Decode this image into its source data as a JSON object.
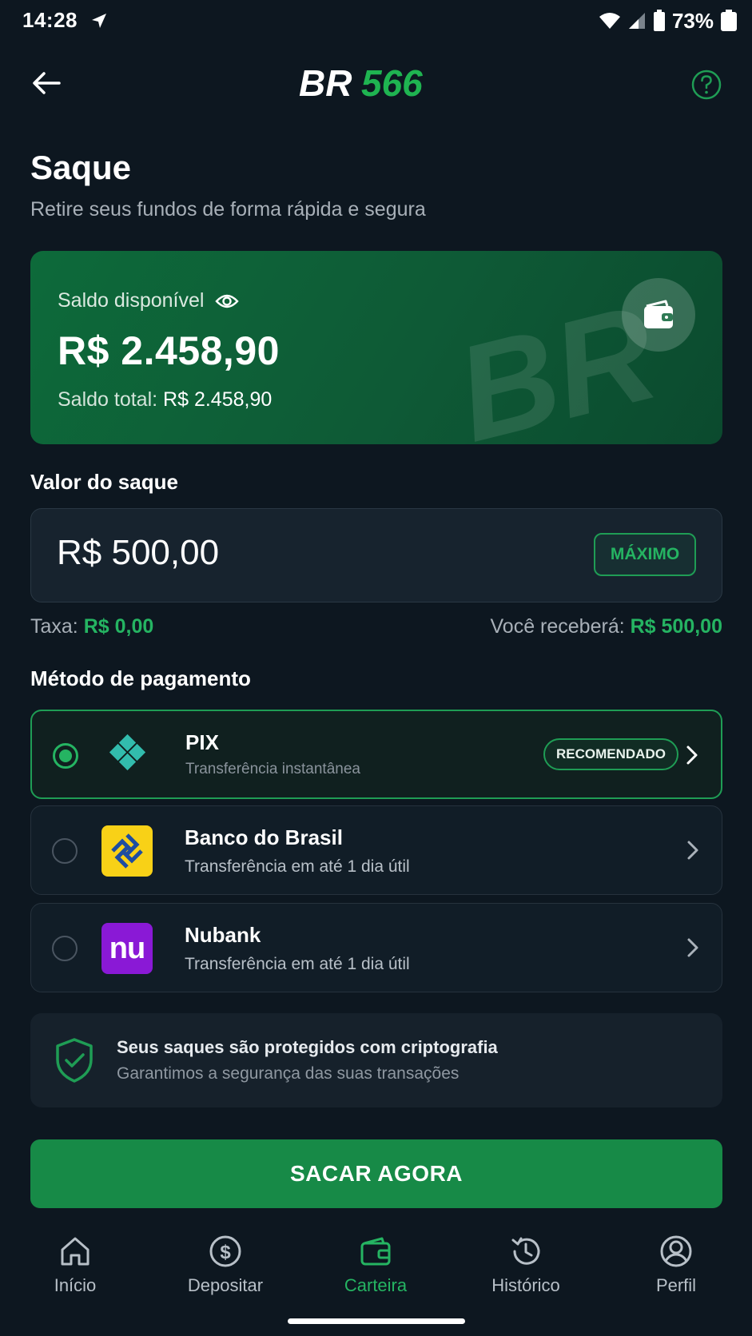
{
  "status_bar": {
    "time": "14:28",
    "battery": "73%",
    "icons": [
      "navigation-icon",
      "wifi-icon",
      "signal-icon",
      "battery-saver-icon",
      "battery-icon"
    ]
  },
  "header": {
    "logo_text_white": "BR",
    "logo_text_green": "566",
    "back_icon": "arrow-left-icon",
    "help_icon": "help-circle-icon"
  },
  "page": {
    "title": "Saque",
    "subtitle": "Retire seus fundos de forma rápida e segura"
  },
  "balance": {
    "label": "Saldo disponível",
    "value": "R$ 2.458,90",
    "total_label": "Saldo total:",
    "total_value": "R$ 2.458,90"
  },
  "amount": {
    "label": "Valor do saque",
    "value": "R$ 500,00",
    "max_label": "MÁXIMO",
    "fee_label": "Taxa:",
    "fee_value": "R$ 0,00",
    "receive_label": "Você receberá:",
    "receive_value": "R$ 500,00"
  },
  "payment": {
    "label": "Método de pagamento",
    "methods": [
      {
        "name": "PIX",
        "desc": "Transferência instantânea",
        "badge": "RECOMENDADO",
        "selected": true
      },
      {
        "name": "Banco do Brasil",
        "desc": "Transferência em até 1 dia útil",
        "selected": false
      },
      {
        "name": "Nubank",
        "desc": "Transferência em até 1 dia útil",
        "logo_text": "nu",
        "selected": false
      }
    ]
  },
  "security": {
    "title": "Seus saques são protegidos com criptografia",
    "desc": "Garantimos a segurança das suas transações"
  },
  "cta": {
    "label": "SACAR AGORA"
  },
  "bottom_nav": {
    "items": [
      {
        "label": "Início",
        "icon": "home-icon",
        "active": false
      },
      {
        "label": "Depositar",
        "icon": "dollar-circle-icon",
        "active": false
      },
      {
        "label": "Carteira",
        "icon": "wallet-icon",
        "active": true
      },
      {
        "label": "Histórico",
        "icon": "history-icon",
        "active": false
      },
      {
        "label": "Perfil",
        "icon": "user-icon",
        "active": false
      }
    ]
  },
  "colors": {
    "background": "#0d1720",
    "accent_green": "#25b462",
    "button_green": "#178a47",
    "card_green": "#0d6a3a"
  }
}
